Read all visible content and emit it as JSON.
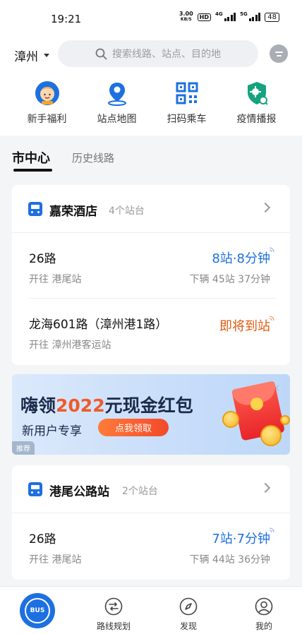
{
  "status_bar": {
    "time": "19:21",
    "net_speed_value": "3.00",
    "net_speed_unit": "KB/S",
    "hd_label": "HD",
    "network_1": "4G",
    "network_2": "5G",
    "battery": "48"
  },
  "header": {
    "city": "漳州",
    "search_placeholder": "搜索线路、站点、目的地"
  },
  "quick_actions": [
    {
      "label": "新手福利",
      "icon": "newbie-gift-icon"
    },
    {
      "label": "站点地图",
      "icon": "map-pin-icon"
    },
    {
      "label": "扫码乘车",
      "icon": "qr-code-icon"
    },
    {
      "label": "疫情播报",
      "icon": "virus-shield-icon"
    }
  ],
  "tabs": {
    "active": "市中心",
    "other": "历史线路"
  },
  "stop_cards": [
    {
      "stop_name": "嘉荣酒店",
      "platform_count": "4个站台",
      "routes": [
        {
          "name": "26路",
          "direction": "开往 港尾站",
          "eta": "8站·8分钟",
          "next": "下辆 45站 37分钟"
        },
        {
          "name": "龙海601路（漳州港1路）",
          "direction": "开往 漳州港客运站",
          "eta": "即将到站",
          "next": ""
        }
      ]
    },
    {
      "stop_name": "港尾公路站",
      "platform_count": "2个站台",
      "routes": [
        {
          "name": "26路",
          "direction": "开往 港尾站",
          "eta": "7站·7分钟",
          "next": "下辆 44站 36分钟"
        }
      ]
    }
  ],
  "banner": {
    "title_pre": "嗨领",
    "title_highlight": "2022",
    "title_post": "元现金红包",
    "subtitle": "新用户专享",
    "button": "点我领取",
    "tag": "推荐",
    "close": "×"
  },
  "tab_bar": {
    "home_badge": "BUS",
    "items": [
      {
        "label": "路线规划",
        "icon": "route-plan-icon"
      },
      {
        "label": "发现",
        "icon": "compass-icon"
      },
      {
        "label": "我的",
        "icon": "profile-icon"
      }
    ]
  },
  "colors": {
    "brand_blue": "#1d70e0",
    "arriving_orange": "#e05a10",
    "banner_highlight": "#f05a28"
  }
}
